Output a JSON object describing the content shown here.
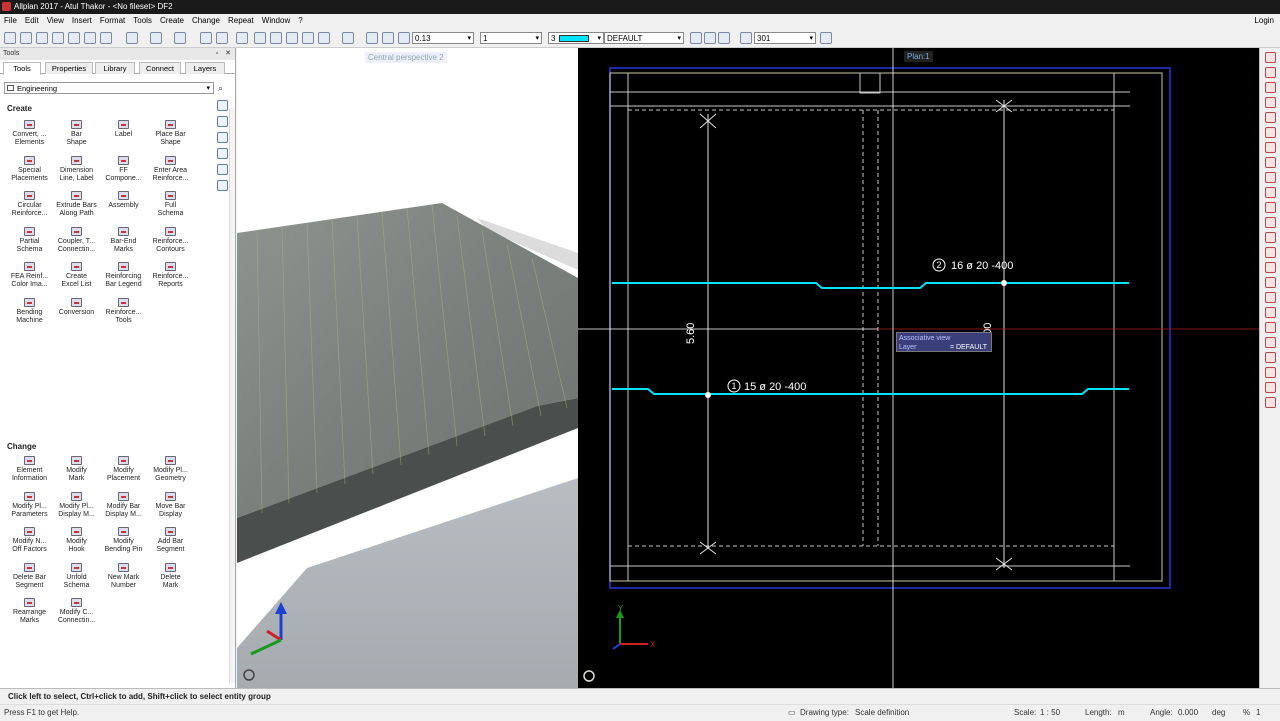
{
  "window": {
    "title": "Allplan 2017 - Atul Thakor - <No fileset> DF2"
  },
  "menu": [
    "File",
    "Edit",
    "View",
    "Insert",
    "Format",
    "Tools",
    "Create",
    "Change",
    "Repeat",
    "Window",
    "?"
  ],
  "menu_login": "Login",
  "toolbar": {
    "pen_value": "0.13",
    "line_value": "1",
    "color_value": "3",
    "layer_value": "DEFAULT",
    "hatch_value": "301",
    "accent_color": "#00e5ff"
  },
  "tools_panel": {
    "title": "Tools",
    "tabs": [
      "Tools",
      "Properties",
      "Library",
      "Connect",
      "Layers"
    ],
    "module": "Engineering",
    "create_section": "Create",
    "create_tools": [
      "Convert, ...\nElements",
      "Bar\nShape",
      "Label",
      "Place Bar\nShape",
      "Special\nPlacements",
      "Dimension\nLine, Label",
      "FF\nCompone...",
      "Enter Area\nReinforce...",
      "Circular\nReinforce...",
      "Extrude Bars\nAlong Path",
      "Assembly",
      "Full\nSchema",
      "Partial\nSchema",
      "Coupler, T...\nConnectin...",
      "Bar-End\nMarks",
      "Reinforce...\nContours",
      "FEA Reinf...\nColor Ima...",
      "Create\nExcel List",
      "Reinforcing\nBar Legend",
      "Reinforce...\nReports",
      "Bending\nMachine",
      "Conversion",
      "Reinforce...\nTools"
    ],
    "change_section": "Change",
    "change_tools": [
      "Element\nInformation",
      "Modify\nMark",
      "Modify\nPlacement",
      "Modify Pl...\nGeometry",
      "Modify Pl...\nParameters",
      "Modify Pl...\nDisplay M...",
      "Modify Bar\nDisplay M...",
      "Move Bar\nDisplay",
      "Modify N...\nOff Factors",
      "Modify\nHook",
      "Modify\nBending Pin",
      "Add Bar\nSegment",
      "Delete Bar\nSegment",
      "Unfold\nSchema",
      "New Mark\nNumber",
      "Delete\nMark",
      "Rearrange\nMarks",
      "Modify C...\nConnectin..."
    ]
  },
  "view3d": {
    "label": "Central perspective 2"
  },
  "plan": {
    "label": "Plan:1",
    "bar_top": {
      "num": "2",
      "text": "16 ø 20 -400"
    },
    "bar_bottom": {
      "num": "1",
      "text": "15 ø 20 -400"
    },
    "dim_left": "5.60",
    "dim_right": "5.00",
    "tooltip_line1": "Associative view",
    "tooltip_line2_label": "Layer",
    "tooltip_line2_value": "= DEFAULT",
    "axis_x": "X",
    "axis_y": "Y"
  },
  "status": {
    "prompt": "Click left to select, Ctrl+click to add, Shift+click to select entity group",
    "help": "Press F1 to get Help.",
    "drawing_type_label": "Drawing type:",
    "drawing_type_value": "Scale definition",
    "scale_label": "Scale:",
    "scale_value": "1 : 50",
    "length_label": "Length:",
    "length_value": "m",
    "angle_label": "Angle:",
    "angle_value": "0.000",
    "angle_unit": "deg",
    "percent_label": "%",
    "percent_value": "1"
  }
}
